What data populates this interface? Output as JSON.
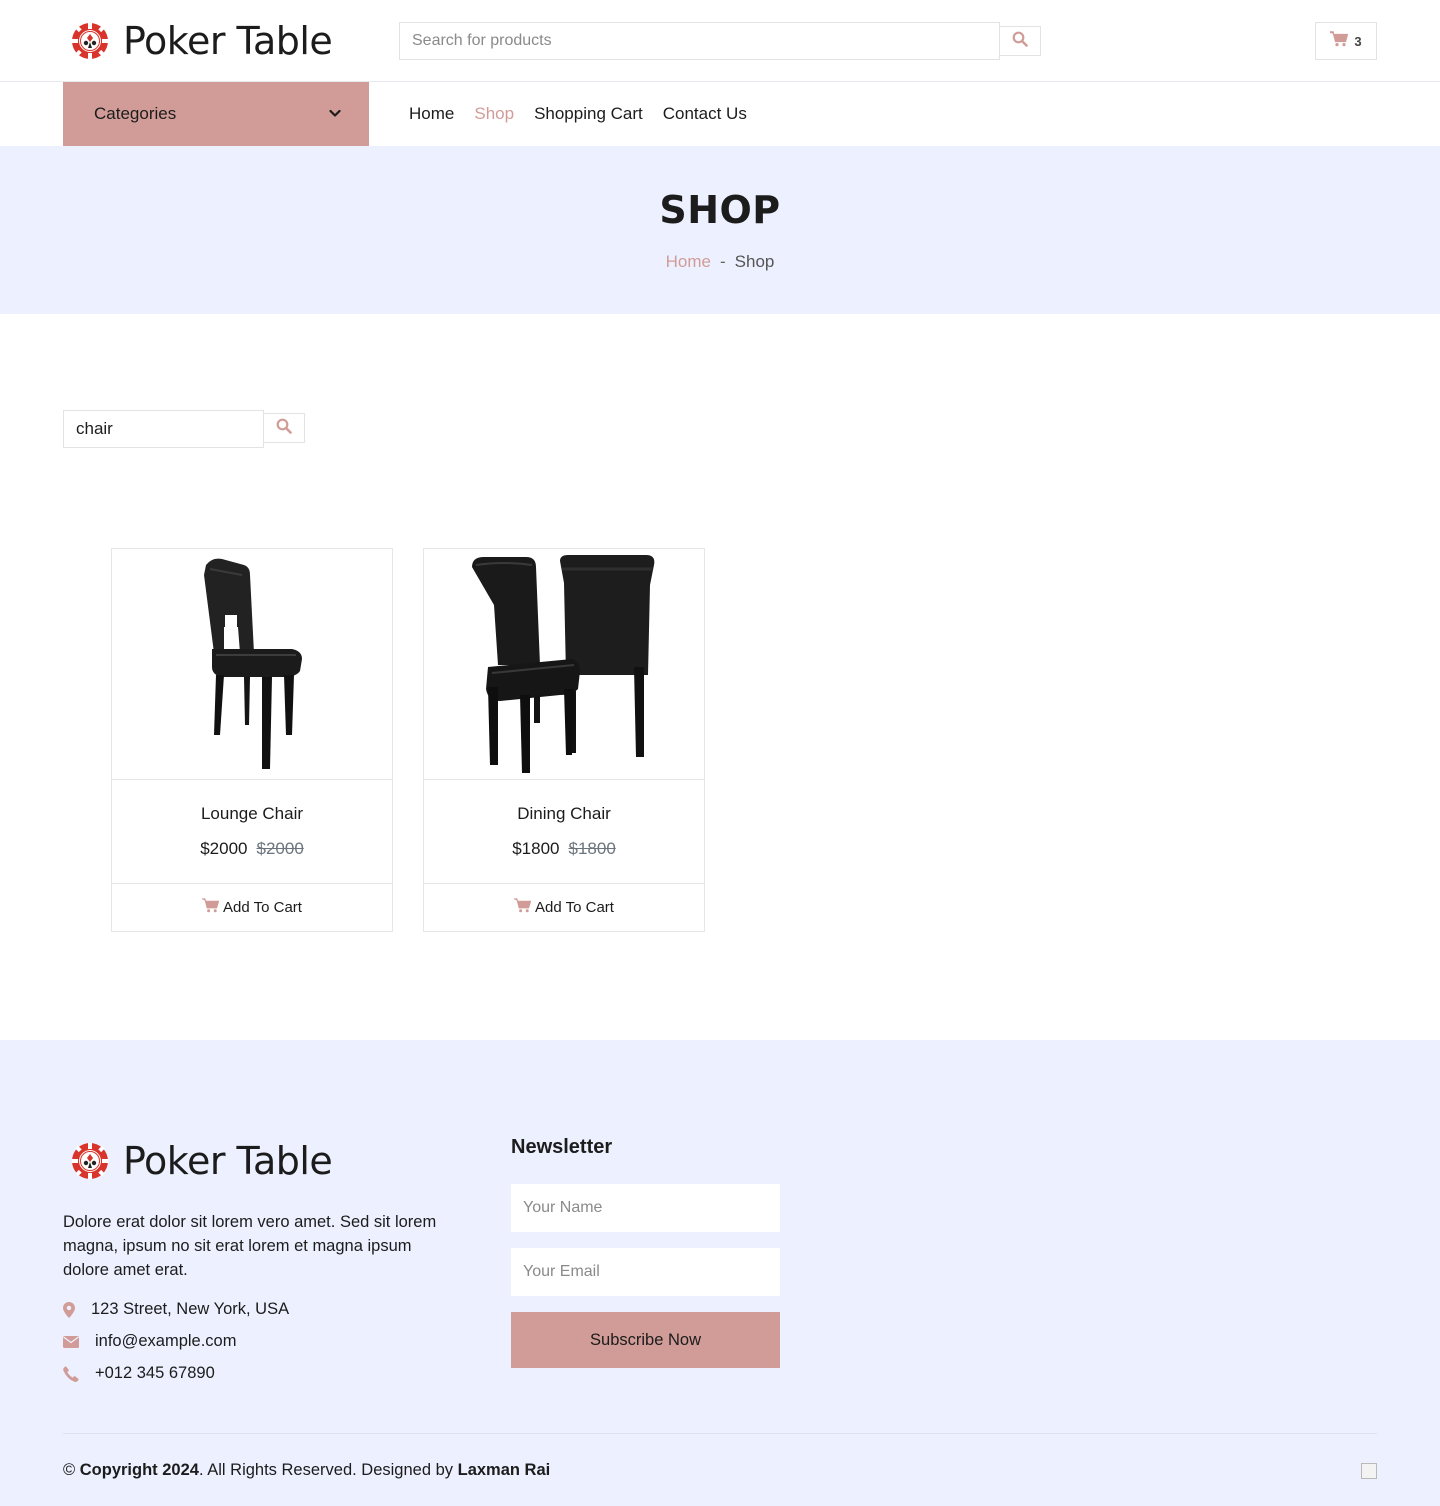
{
  "brand": {
    "name": "Poker Table"
  },
  "header": {
    "search_placeholder": "Search for products",
    "cart_count": "3"
  },
  "nav": {
    "categories_label": "Categories",
    "links": [
      "Home",
      "Shop",
      "Shopping Cart",
      "Contact Us"
    ],
    "active": "Shop"
  },
  "page_header": {
    "title": "SHOP",
    "breadcrumb": {
      "home": "Home",
      "separator": "-",
      "current": "Shop"
    }
  },
  "shop_search": {
    "value": "chair"
  },
  "products": [
    {
      "name": "Lounge Chair",
      "price": "$2000",
      "old_price": "$2000",
      "action": "Add To Cart"
    },
    {
      "name": "Dining Chair",
      "price": "$1800",
      "old_price": "$1800",
      "action": "Add To Cart"
    }
  ],
  "footer": {
    "description": "Dolore erat dolor sit lorem vero amet. Sed sit lorem magna, ipsum no sit erat lorem et magna ipsum dolore amet erat.",
    "address": "123 Street, New York, USA",
    "email": "info@example.com",
    "phone": "+012 345 67890",
    "newsletter": {
      "title": "Newsletter",
      "name_placeholder": "Your Name",
      "email_placeholder": "Your Email",
      "button": "Subscribe Now"
    },
    "copyright": {
      "symbol": "©",
      "bold_text": "Copyright 2024",
      "text": ". All Rights Reserved. Designed by",
      "designer": "Laxman Rai"
    }
  },
  "colors": {
    "accent": "#d19c97",
    "light_bg": "#edf1ff",
    "text": "#1c1c1c"
  }
}
